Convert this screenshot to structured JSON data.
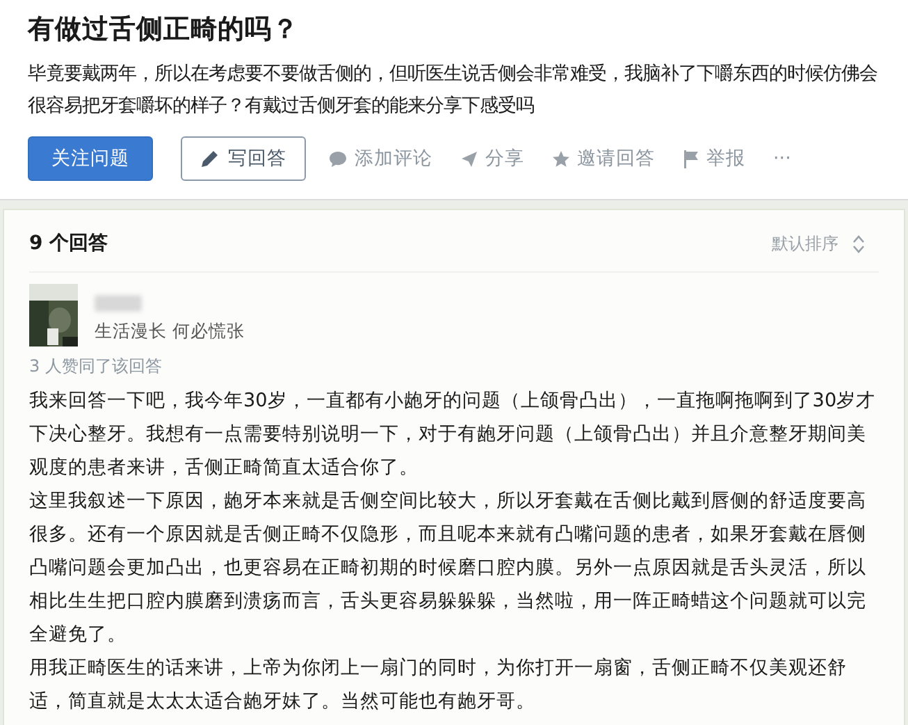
{
  "question": {
    "title": "有做过舌侧正畸的吗？",
    "description": "毕竟要戴两年，所以在考虑要不要做舌侧的，但听医生说舌侧会非常难受，我脑补了下嚼东西的时候仿佛会很容易把牙套嚼坏的样子？有戴过舌侧牙套的能来分享下感受吗",
    "actions": [
      {
        "kind": "primary",
        "label": "关注问题"
      },
      {
        "kind": "outline",
        "label": "写回答"
      },
      {
        "kind": "comment",
        "label": "添加评论"
      },
      {
        "kind": "share",
        "label": "分享"
      },
      {
        "kind": "invite",
        "label": "邀请回答"
      },
      {
        "kind": "report",
        "label": "举报"
      },
      {
        "kind": "more",
        "label": "···"
      }
    ]
  },
  "answers": {
    "count": "9 个回答",
    "sort": "默认排序",
    "items": [
      {
        "author": {
          "kind": "picture",
          "bio": "生活漫长 何必慌张"
        },
        "votes": "3 人赞同了该回答",
        "paragraphs": [
          "我来回答一下吧，我今年30岁，一直都有小龅牙的问题（上颌骨凸出），一直拖啊拖啊到了30岁才下决心整牙。我想有一点需要特别说明一下，对于有龅牙问题（上颌骨凸出）并且介意整牙期间美观度的患者来讲，舌侧正畸简直太适合你了。",
          "这里我叙述一下原因，龅牙本来就是舌侧空间比较大，所以牙套戴在舌侧比戴到唇侧的舒适度要高很多。还有一个原因就是舌侧正畸不仅隐形，而且呢本来就有凸嘴问题的患者，如果牙套戴在唇侧凸嘴问题会更加凸出，也更容易在正畸初期的时候磨口腔内膜。另外一点原因就是舌头灵活，所以相比生生把口腔内膜磨到溃疡而言，舌头更容易躲躲躲，当然啦，用一阵正畸蜡这个问题就可以完全避免了。",
          "用我正畸医生的话来讲，上帝为你闭上一扇门的同时，为你打开一扇窗，舌侧正畸不仅美观还舒适，简直就是太太太适合龅牙妹了。当然可能也有龅牙哥。"
        ]
      }
    ]
  }
}
